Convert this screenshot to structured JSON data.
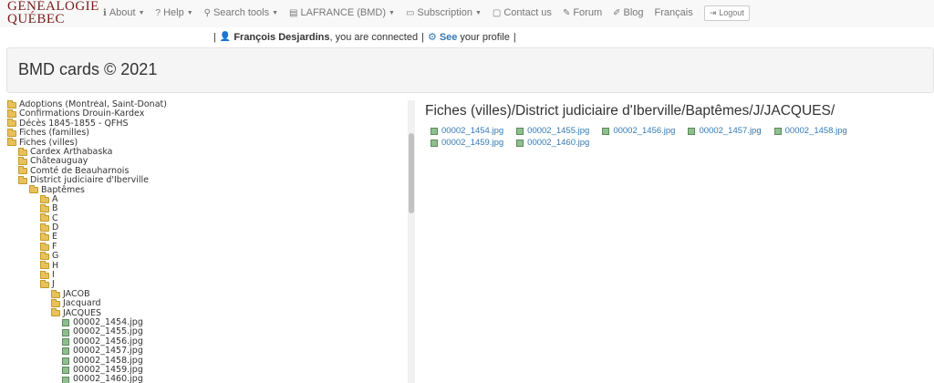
{
  "logo": {
    "line1": "GÉNÉALOGIE",
    "line2": "QUÉBEC"
  },
  "nav": [
    {
      "label": "About",
      "icon": "info-icon",
      "glyph": "ℹ",
      "caret": true
    },
    {
      "label": "Help",
      "icon": "question-icon",
      "glyph": "?",
      "caret": true
    },
    {
      "label": "Search tools",
      "icon": "search-icon",
      "glyph": "⚲",
      "caret": true
    },
    {
      "label": "LAFRANCE (BMD)",
      "icon": "database-icon",
      "glyph": "▤",
      "caret": true
    },
    {
      "label": "Subscription",
      "icon": "credit-card-icon",
      "glyph": "▭",
      "caret": true
    },
    {
      "label": "Contact us",
      "icon": "contact-icon",
      "glyph": "▢",
      "caret": false
    },
    {
      "label": "Forum",
      "icon": "forum-icon",
      "glyph": "✎",
      "caret": false
    },
    {
      "label": "Blog",
      "icon": "blog-icon",
      "glyph": "✐",
      "caret": false
    },
    {
      "label": "Français",
      "icon": "",
      "glyph": "",
      "caret": false
    }
  ],
  "logout": {
    "label": "Logout"
  },
  "connected": {
    "user": "François Desjardins",
    "text": ", you are connected",
    "see": "See",
    "profile_text": "your profile"
  },
  "page_title": "BMD cards © 2021",
  "tree": [
    {
      "label": "Adoptions (Montréal, Saint-Donat)",
      "level": 0,
      "type": "folder"
    },
    {
      "label": "Confirmations Drouin-Kardex",
      "level": 0,
      "type": "folder"
    },
    {
      "label": "Décès 1845-1855 - QFHS",
      "level": 0,
      "type": "folder"
    },
    {
      "label": "Fiches (familles)",
      "level": 0,
      "type": "folder"
    },
    {
      "label": "Fiches (villes)",
      "level": 0,
      "type": "folder"
    },
    {
      "label": "Cardex Arthabaska",
      "level": 1,
      "type": "folder"
    },
    {
      "label": "Châteauguay",
      "level": 1,
      "type": "folder"
    },
    {
      "label": "Comté de Beauharnois",
      "level": 1,
      "type": "folder"
    },
    {
      "label": "District judiciaire d'Iberville",
      "level": 1,
      "type": "folder"
    },
    {
      "label": "Baptêmes",
      "level": 2,
      "type": "folder"
    },
    {
      "label": "A",
      "level": 3,
      "type": "folder"
    },
    {
      "label": "B",
      "level": 3,
      "type": "folder"
    },
    {
      "label": "C",
      "level": 3,
      "type": "folder"
    },
    {
      "label": "D",
      "level": 3,
      "type": "folder"
    },
    {
      "label": "E",
      "level": 3,
      "type": "folder"
    },
    {
      "label": "F",
      "level": 3,
      "type": "folder"
    },
    {
      "label": "G",
      "level": 3,
      "type": "folder"
    },
    {
      "label": "H",
      "level": 3,
      "type": "folder"
    },
    {
      "label": "I",
      "level": 3,
      "type": "folder"
    },
    {
      "label": "J",
      "level": 3,
      "type": "folder"
    },
    {
      "label": "JACOB",
      "level": 4,
      "type": "folder"
    },
    {
      "label": "Jacquard",
      "level": 4,
      "type": "folder"
    },
    {
      "label": "JACQUES",
      "level": 4,
      "type": "folder"
    },
    {
      "label": "00002_1454.jpg",
      "level": 5,
      "type": "file"
    },
    {
      "label": "00002_1455.jpg",
      "level": 5,
      "type": "file"
    },
    {
      "label": "00002_1456.jpg",
      "level": 5,
      "type": "file"
    },
    {
      "label": "00002_1457.jpg",
      "level": 5,
      "type": "file"
    },
    {
      "label": "00002_1458.jpg",
      "level": 5,
      "type": "file"
    },
    {
      "label": "00002_1459.jpg",
      "level": 5,
      "type": "file"
    },
    {
      "label": "00002_1460.jpg",
      "level": 5,
      "type": "file"
    }
  ],
  "content": {
    "path": "Fiches (villes)/District judiciaire d'Iberville/Baptêmes/J/JACQUES/",
    "files": [
      "00002_1454.jpg",
      "00002_1455.jpg",
      "00002_1456.jpg",
      "00002_1457.jpg",
      "00002_1458.jpg",
      "00002_1459.jpg",
      "00002_1460.jpg"
    ]
  },
  "colors": {
    "link": "#337ab7",
    "logo": "#7a1a1a",
    "folder": "#e8c15a"
  }
}
